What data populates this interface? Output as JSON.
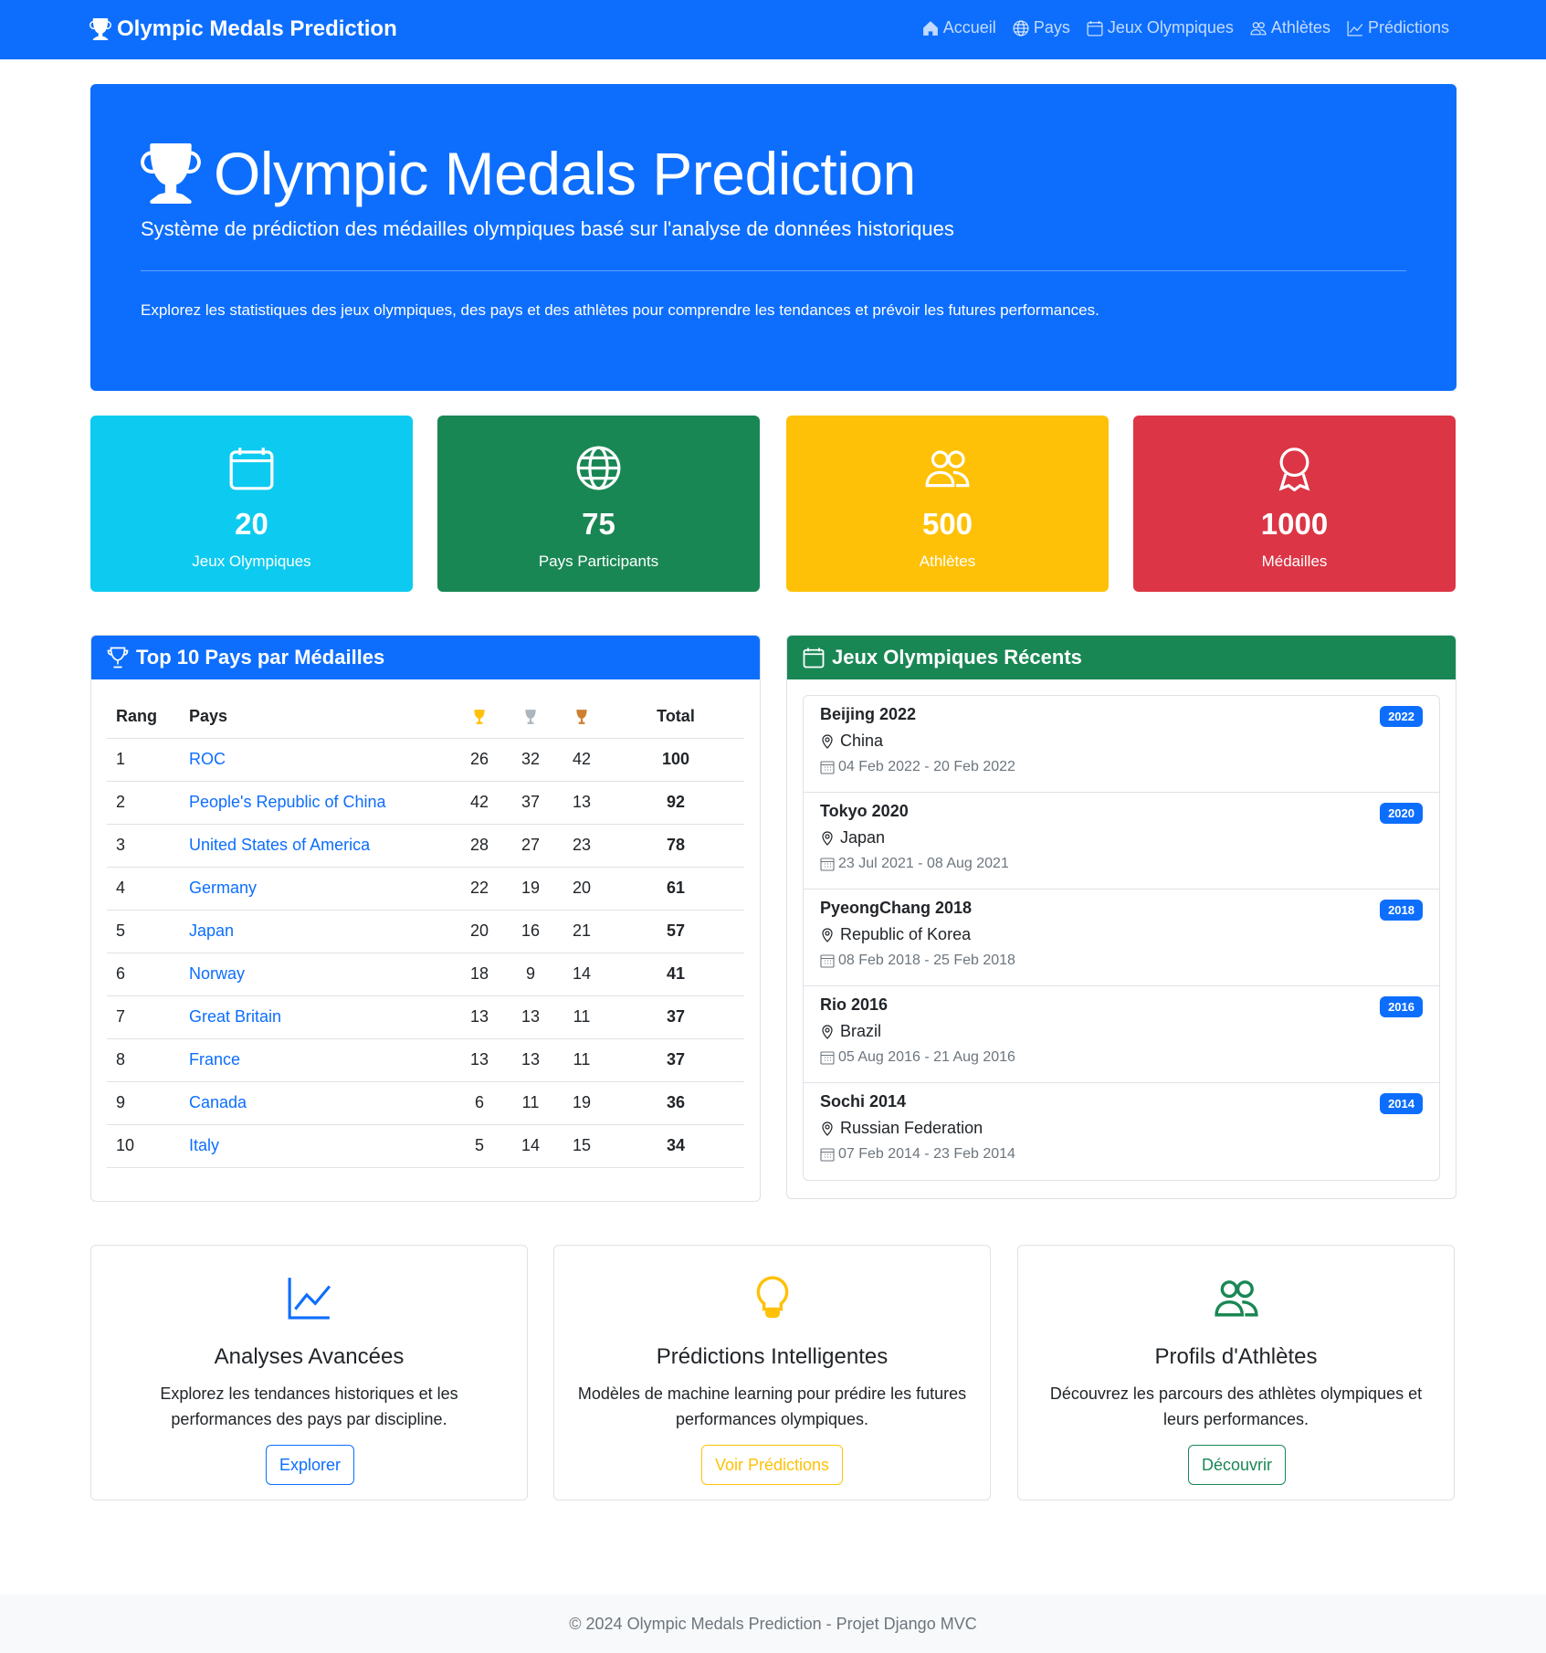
{
  "nav": {
    "brand": "Olympic Medals Prediction",
    "items": [
      {
        "label": "Accueil",
        "icon": "home-icon"
      },
      {
        "label": "Pays",
        "icon": "globe-icon"
      },
      {
        "label": "Jeux Olympiques",
        "icon": "calendar-icon"
      },
      {
        "label": "Athlètes",
        "icon": "people-icon"
      },
      {
        "label": "Prédictions",
        "icon": "chart-icon"
      }
    ]
  },
  "hero": {
    "title": "Olympic Medals Prediction",
    "subtitle": "Système de prédiction des médailles olympiques basé sur l'analyse de données historiques",
    "text": "Explorez les statistiques des jeux olympiques, des pays et des athlètes pour comprendre les tendances et prévoir les futures performances."
  },
  "stats": [
    {
      "value": "20",
      "label": "Jeux Olympiques",
      "color": "#0dcaf0"
    },
    {
      "value": "75",
      "label": "Pays Participants",
      "color": "#198754"
    },
    {
      "value": "500",
      "label": "Athlètes",
      "color": "#ffc107"
    },
    {
      "value": "1000",
      "label": "Médailles",
      "color": "#dc3545"
    }
  ],
  "top10": {
    "title": "Top 10 Pays par Médailles",
    "headers": {
      "rank": "Rang",
      "country": "Pays",
      "total": "Total"
    },
    "medal_colors": {
      "gold": "#ffc107",
      "silver": "#adb5bd",
      "bronze": "#cd7f32"
    },
    "rows": [
      {
        "rank": "1",
        "country": "ROC",
        "gold": "26",
        "silver": "32",
        "bronze": "42",
        "total": "100"
      },
      {
        "rank": "2",
        "country": "People's Republic of China",
        "gold": "42",
        "silver": "37",
        "bronze": "13",
        "total": "92"
      },
      {
        "rank": "3",
        "country": "United States of America",
        "gold": "28",
        "silver": "27",
        "bronze": "23",
        "total": "78"
      },
      {
        "rank": "4",
        "country": "Germany",
        "gold": "22",
        "silver": "19",
        "bronze": "20",
        "total": "61"
      },
      {
        "rank": "5",
        "country": "Japan",
        "gold": "20",
        "silver": "16",
        "bronze": "21",
        "total": "57"
      },
      {
        "rank": "6",
        "country": "Norway",
        "gold": "18",
        "silver": "9",
        "bronze": "14",
        "total": "41"
      },
      {
        "rank": "7",
        "country": "Great Britain",
        "gold": "13",
        "silver": "13",
        "bronze": "11",
        "total": "37"
      },
      {
        "rank": "8",
        "country": "France",
        "gold": "13",
        "silver": "13",
        "bronze": "11",
        "total": "37"
      },
      {
        "rank": "9",
        "country": "Canada",
        "gold": "6",
        "silver": "11",
        "bronze": "19",
        "total": "36"
      },
      {
        "rank": "10",
        "country": "Italy",
        "gold": "5",
        "silver": "14",
        "bronze": "15",
        "total": "34"
      }
    ]
  },
  "recent": {
    "title": "Jeux Olympiques Récents",
    "games": [
      {
        "name": "Beijing 2022",
        "country": "China",
        "dates": "04 Feb 2022 - 20 Feb 2022",
        "year": "2022"
      },
      {
        "name": "Tokyo 2020",
        "country": "Japan",
        "dates": "23 Jul 2021 - 08 Aug 2021",
        "year": "2020"
      },
      {
        "name": "PyeongChang 2018",
        "country": "Republic of Korea",
        "dates": "08 Feb 2018 - 25 Feb 2018",
        "year": "2018"
      },
      {
        "name": "Rio 2016",
        "country": "Brazil",
        "dates": "05 Aug 2016 - 21 Aug 2016",
        "year": "2016"
      },
      {
        "name": "Sochi 2014",
        "country": "Russian Federation",
        "dates": "07 Feb 2014 - 23 Feb 2014",
        "year": "2014"
      }
    ]
  },
  "features": [
    {
      "title": "Analyses Avancées",
      "desc": "Explorez les tendances historiques et les performances des pays par discipline.",
      "button": "Explorer",
      "color": "#0d6efd"
    },
    {
      "title": "Prédictions Intelligentes",
      "desc": "Modèles de machine learning pour prédire les futures performances olympiques.",
      "button": "Voir Prédictions",
      "color": "#ffc107"
    },
    {
      "title": "Profils d'Athlètes",
      "desc": "Découvrez les parcours des athlètes olympiques et leurs performances.",
      "button": "Découvrir",
      "color": "#198754"
    }
  ],
  "footer": "© 2024 Olympic Medals Prediction - Projet Django MVC"
}
